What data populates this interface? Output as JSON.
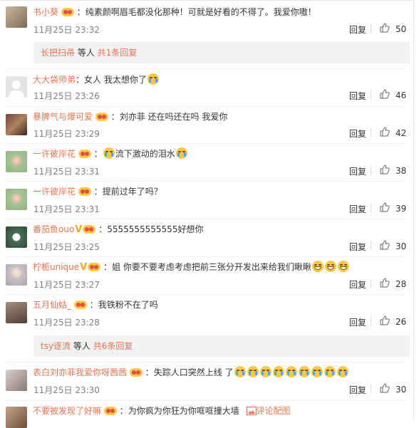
{
  "comments": [
    {
      "user": "书小葵",
      "sep": "：",
      "text": "纯素颜啊眉毛都没化那种！可就是好看的不得了。我爱你嗷！",
      "time": "11月25日 23:32",
      "reply": "回复",
      "likes": "50"
    },
    {
      "user": "大大袋师弟",
      "sep": "：",
      "text": "女人  我太想你了",
      "time": "11月25日 23:26",
      "reply": "回复",
      "likes": "46"
    },
    {
      "user": "暴脾气与爆可爱",
      "sep": "：",
      "text": "刘亦菲 还在吗还在吗 我爱你",
      "time": "11月25日 23:29",
      "reply": "回复",
      "likes": "42"
    },
    {
      "user": "一许彼岸花",
      "sep": "：",
      "text": "流下激动的泪水",
      "time": "11月25日 23:31",
      "reply": "回复",
      "likes": "38"
    },
    {
      "user": "一许彼岸花",
      "sep": "：",
      "text": "提前过年了吗？",
      "time": "11月25日 23:31",
      "reply": "回复",
      "likes": "39"
    },
    {
      "user": "番茄鱼ouo",
      "sep": "：",
      "text": "5555555555555好想你",
      "time": "11月25日 23:25",
      "reply": "回复",
      "likes": "30"
    },
    {
      "user": "柠栀unique",
      "sep": "：",
      "text": "姐 你要不要考虑考虑把前三张分开发出来给我们瞅瞅",
      "time": "11月25日 23:27",
      "reply": "回复",
      "likes": "28"
    },
    {
      "user": "五月仙姑_",
      "sep": "：",
      "text": "我铁粉不在了吗",
      "time": "11月25日 23:28",
      "reply": "回复",
      "likes": "26"
    },
    {
      "user": "表白刘亦菲我爱你呀茜茜",
      "sep": "：",
      "text": "失踪人口突然上线 了",
      "time": "11月25日 23:30",
      "reply": "回复",
      "likes": "30"
    },
    {
      "user": "不要被发现了好嘛",
      "sep": "：",
      "text": "为你疯为你狂为你哐哐撞大墙",
      "time": "",
      "reply": "",
      "likes": ""
    }
  ],
  "sub_replies": [
    {
      "user": "长把扫帚",
      "suffix": " 等人 ",
      "count": "共1条回复"
    },
    {
      "user": "tsy逐流",
      "suffix": " 等人 ",
      "count": "共6条回复"
    }
  ],
  "last_comment_extra": {
    "label": "评论配图"
  },
  "colors": {
    "username": "#eb7350",
    "text": "#333333",
    "time": "#808080",
    "subbox": "#f2f2f5"
  }
}
